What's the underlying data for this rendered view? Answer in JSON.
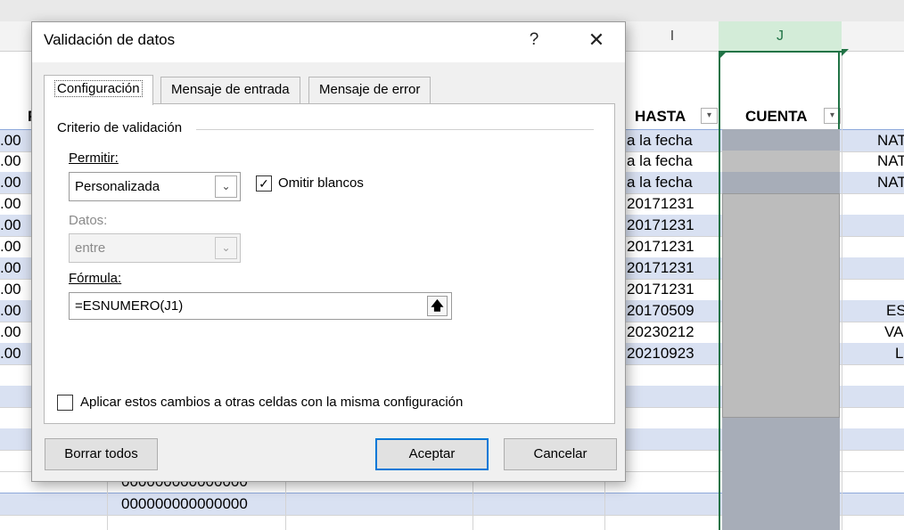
{
  "sheet": {
    "col_I": "I",
    "col_J": "J",
    "hdr_F_partial": "F",
    "hdr_hasta": "HASTA",
    "hdr_cuenta": "CUENTA",
    "filter_glyph": "▾",
    "rows": [
      {
        "f": ".00",
        "hasta": "a la fecha",
        "right": "NAT"
      },
      {
        "f": ".00",
        "hasta": "a la fecha",
        "right": "NAT"
      },
      {
        "f": ".00",
        "hasta": "a la fecha",
        "right": "NAT"
      },
      {
        "f": ".00",
        "hasta": "20171231",
        "right": ""
      },
      {
        "f": ".00",
        "hasta": "20171231",
        "right": ""
      },
      {
        "f": ".00",
        "hasta": "20171231",
        "right": ""
      },
      {
        "f": ".00",
        "hasta": "20171231",
        "right": ""
      },
      {
        "f": ".00",
        "hasta": "20171231",
        "right": ""
      },
      {
        "f": ".00",
        "hasta": "20170509",
        "right": "ES"
      },
      {
        "f": ".00",
        "hasta": "20230212",
        "right": "VA"
      },
      {
        "f": ".00",
        "hasta": "20210923",
        "right": "L"
      }
    ],
    "bottom_zeros": [
      "000000000000000",
      "000000000000000"
    ]
  },
  "dialog": {
    "title": "Validación de datos",
    "help": "?",
    "close": "✕",
    "tabs": [
      {
        "label": "Configuración"
      },
      {
        "label": "Mensaje de entrada"
      },
      {
        "label": "Mensaje de error"
      }
    ],
    "group_title": "Criterio de validación",
    "allow_label": "Permitir:",
    "allow_value": "Personalizada",
    "ignore_blank_label": "Omitir blancos",
    "ignore_blank_checked": true,
    "data_label": "Datos:",
    "data_value": "entre",
    "formula_label": "Fórmula:",
    "formula_value": "=ESNUMERO(J1)",
    "apply_all_label": "Aplicar estos cambios a otras celdas con la misma configuración",
    "apply_all_checked": false,
    "clear_all": "Borrar todos",
    "ok": "Aceptar",
    "cancel": "Cancelar"
  },
  "colors": {
    "accent": "#0078d7",
    "excel_green": "#217346",
    "band": "#d9e1f2",
    "j_fill": "#a6a6a6"
  }
}
